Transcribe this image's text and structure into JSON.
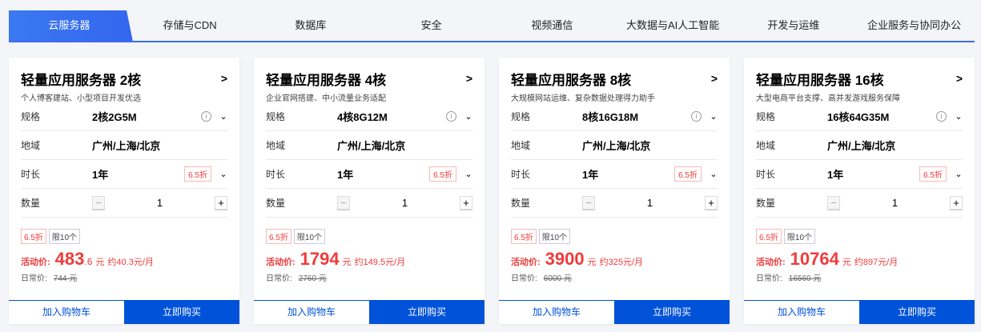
{
  "tabs": [
    "云服务器",
    "存储与CDN",
    "数据库",
    "安全",
    "视频通信",
    "大数据与AI人工智能",
    "开发与运维",
    "企业服务与协同办公"
  ],
  "labels": {
    "spec": "规格",
    "region": "地域",
    "duration": "时长",
    "quantity": "数量",
    "promo": "活动价:",
    "regular": "日常价:",
    "yuan": "元",
    "cart": "加入购物车",
    "buy": "立即购买",
    "limit": "限10个",
    "info": "i"
  },
  "cards": [
    {
      "title": "轻量应用服务器 2核",
      "subtitle": "个人博客建站、小型项目开发优选",
      "spec": "2核2G5M",
      "region": "广州/上海/北京",
      "duration": "1年",
      "discount": "6.5折",
      "qty": "1",
      "price_int": "483",
      "price_dec": ".6",
      "monthly": "约40.3元/月",
      "old": "744"
    },
    {
      "title": "轻量应用服务器 4核",
      "subtitle": "企业官网搭建、中小流量业务适配",
      "spec": "4核8G12M",
      "region": "广州/上海/北京",
      "duration": "1年",
      "discount": "6.5折",
      "qty": "1",
      "price_int": "1794",
      "price_dec": "",
      "monthly": "约149.5元/月",
      "old": "2760"
    },
    {
      "title": "轻量应用服务器 8核",
      "subtitle": "大规模网站运维、复杂数据处理得力助手",
      "spec": "8核16G18M",
      "region": "广州/上海/北京",
      "duration": "1年",
      "discount": "6.5折",
      "qty": "1",
      "price_int": "3900",
      "price_dec": "",
      "monthly": "约325元/月",
      "old": "6000"
    },
    {
      "title": "轻量应用服务器 16核",
      "subtitle": "大型电商平台支撑、高并发游戏服务保障",
      "spec": "16核64G35M",
      "region": "广州/上海/北京",
      "duration": "1年",
      "discount": "6.5折",
      "qty": "1",
      "price_int": "10764",
      "price_dec": "",
      "monthly": "约897元/月",
      "old": "16560"
    }
  ]
}
